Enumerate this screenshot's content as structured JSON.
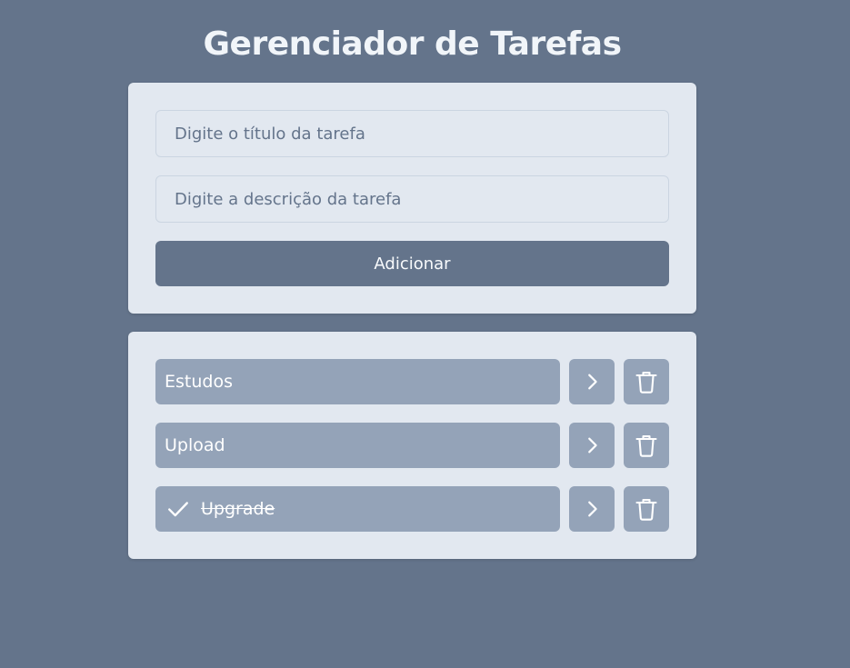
{
  "header": {
    "title": "Gerenciador de Tarefas"
  },
  "form": {
    "title_placeholder": "Digite o título da tarefa",
    "description_placeholder": "Digite a descrição da tarefa",
    "add_label": "Adicionar"
  },
  "tasks": [
    {
      "title": "Estudos",
      "completed": false
    },
    {
      "title": "Upload",
      "completed": false
    },
    {
      "title": "Upgrade",
      "completed": true
    }
  ],
  "icons": {
    "complete": "check-icon",
    "details": "chevron-right-icon",
    "delete": "trash-icon"
  },
  "colors": {
    "background": "#64748b",
    "card": "#e2e8f0",
    "task": "#94a3b8",
    "button": "#64748b",
    "text": "#ffffff"
  }
}
